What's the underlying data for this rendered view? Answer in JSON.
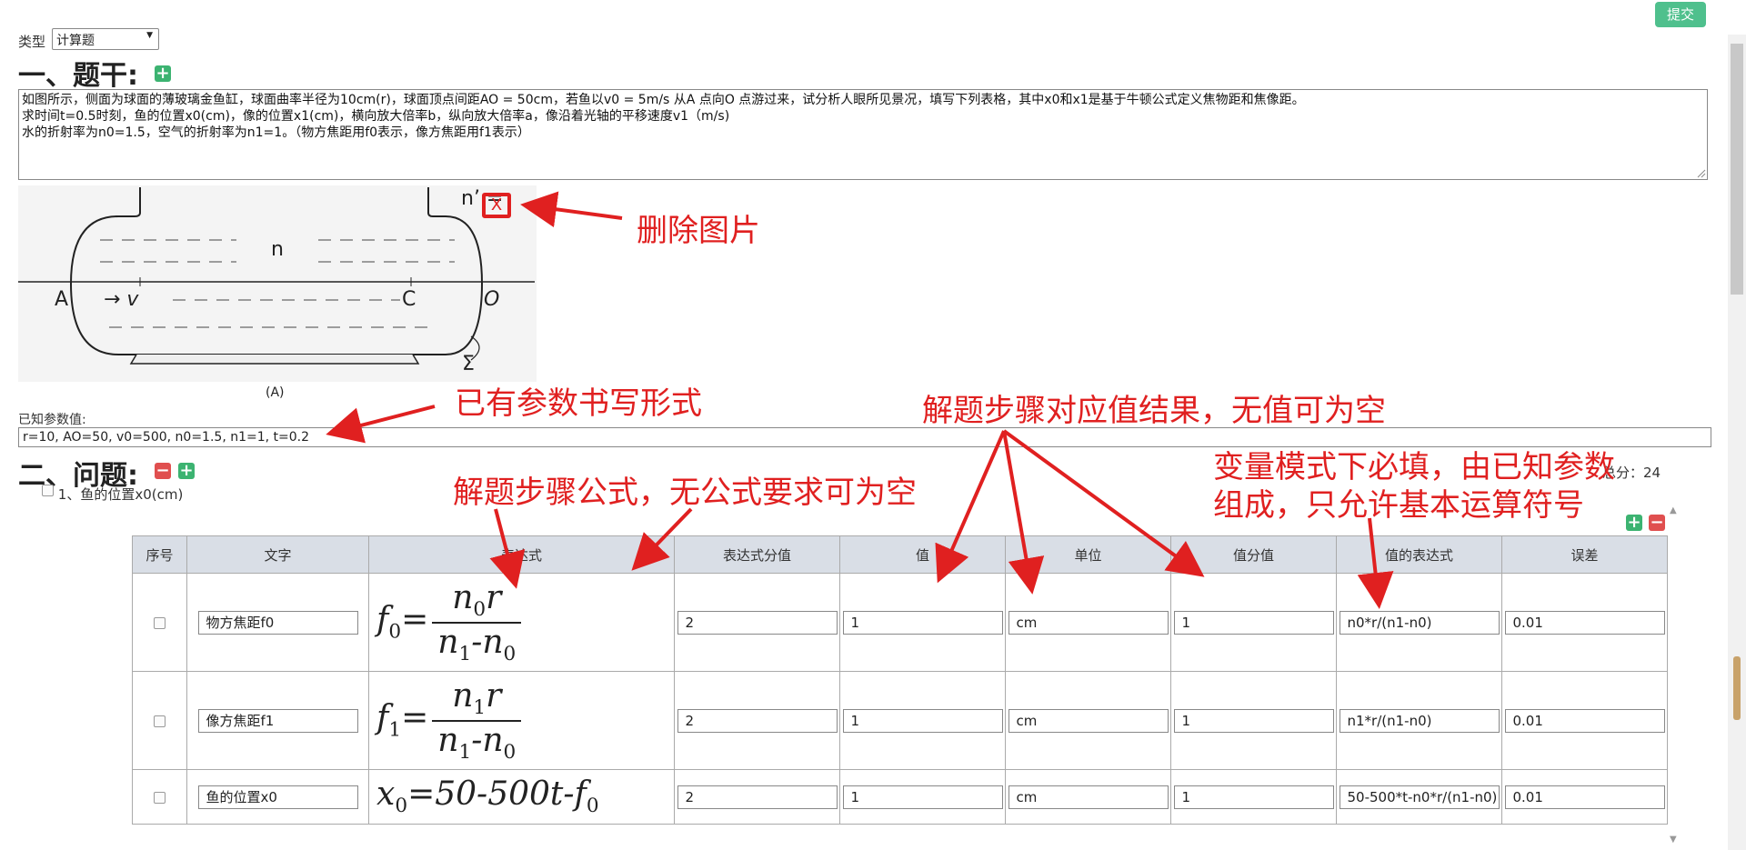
{
  "toolbar": {
    "submit_label": "提交"
  },
  "type": {
    "label": "类型",
    "selected": "计算题"
  },
  "stem": {
    "heading": "一、题干:",
    "text": "如图所示，侧面为球面的薄玻璃金鱼缸，球面曲率半径为10cm(r)，球面顶点间距AO = 50cm，若鱼以v0 = 5m/s 从A 点向O 点游过来，试分析人眼所见景况，填写下列表格，其中x0和x1是基于牛顿公式定义焦物距和焦像距。\n求时间t=0.5时刻，鱼的位置x0(cm)，像的位置x1(cm)，横向放大倍率b，纵向放大倍率a，像沿着光轴的平移速度v1（m/s)\n水的折射率为n0=1.5，空气的折射率为n1=1。（物方焦距用f0表示，像方焦距用f1表示）"
  },
  "figure": {
    "label_n_prime": "n’ =",
    "delete_x": "X",
    "label_n": "n",
    "label_A": "A",
    "label_v": "→ v",
    "label_C": "C",
    "label_O": "O",
    "label_sigma": "Σ",
    "caption": "(A)"
  },
  "known_params": {
    "label": "已知参数值:",
    "value": "r=10, AO=50, v0=500, n0=1.5, n1=1, t=0.2"
  },
  "questions": {
    "heading": "二、问题:",
    "total_score": "总分：24",
    "item1": "1、鱼的位置x0(cm)"
  },
  "table": {
    "headers": [
      "序号",
      "文字",
      "表达式",
      "表达式分值",
      "值",
      "单位",
      "值分值",
      "值的表达式",
      "误差"
    ],
    "rows": [
      {
        "text": "物方焦距f0",
        "expr_score": "2",
        "value": "1",
        "unit": "cm",
        "value_score": "1",
        "value_expr": "n0*r/(n1-n0)",
        "error": "0.01"
      },
      {
        "text": "像方焦距f1",
        "expr_score": "2",
        "value": "1",
        "unit": "cm",
        "value_score": "1",
        "value_expr": "n1*r/(n1-n0)",
        "error": "0.01"
      },
      {
        "text": "鱼的位置x0",
        "expr_score": "2",
        "value": "1",
        "unit": "cm",
        "value_score": "1",
        "value_expr": "50-500*t-n0*r/(n1-n0)",
        "error": "0.01"
      }
    ]
  },
  "formulas": {
    "f0_lhs": "f",
    "f0_sub": "0",
    "f1_lhs": "f",
    "f1_sub": "1",
    "x0_lhs": "x",
    "x0_sub": "0",
    "x0_rhs": "=50-500t-f",
    "eq": "=",
    "n0": "n",
    "n1": "n",
    "r": "r",
    "minus": "-"
  },
  "annotations": {
    "delete_image": "删除图片",
    "param_format": "已有参数书写形式",
    "step_value": "解题步骤对应值结果，无值可为空",
    "step_formula": "解题步骤公式，无公式要求可为空",
    "var_mode_line1": "变量模式下必填，由已知参数",
    "var_mode_line2": "组成，只允许基本运算符号"
  },
  "colors": {
    "accent": "#4fc08d",
    "annotation": "#e02020",
    "header_bg": "#d9dee6"
  }
}
